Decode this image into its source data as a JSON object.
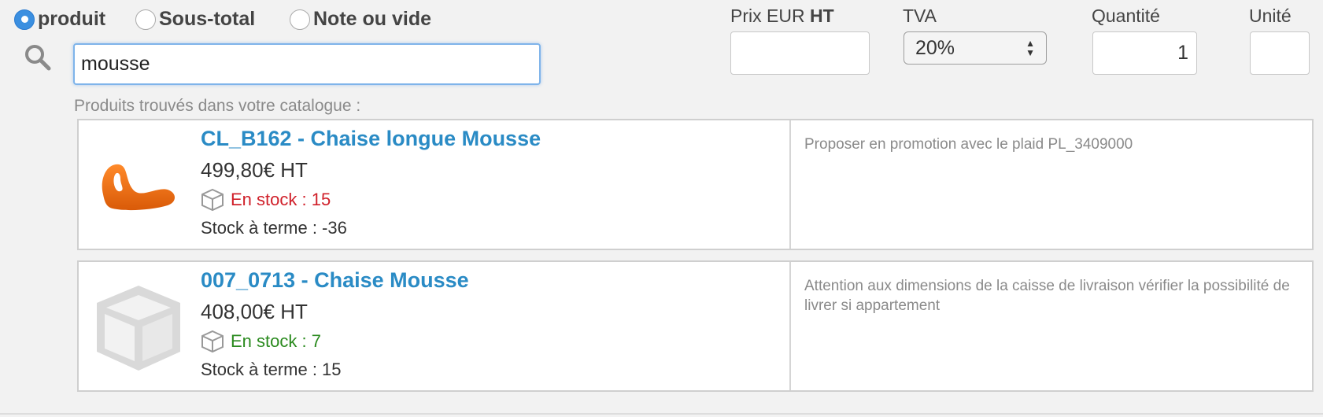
{
  "line_type": {
    "options": [
      {
        "label": "produit",
        "checked": true
      },
      {
        "label": "Sous-total",
        "checked": false
      },
      {
        "label": "Note ou vide",
        "checked": false
      }
    ]
  },
  "search": {
    "value": "mousse",
    "icon": "search-icon"
  },
  "fields": {
    "price_label": "Prix EUR ",
    "price_label_bold": "HT",
    "price_value": "",
    "tva_label": "TVA",
    "tva_value": "20%",
    "qty_label": "Quantité",
    "qty_value": "1",
    "unit_label": "Unité",
    "unit_value": ""
  },
  "results": {
    "heading": "Produits trouvés dans votre catalogue :",
    "items": [
      {
        "title": "CL_B162 - Chaise longue Mousse",
        "price": "499,80€ HT",
        "stock": "En stock : 15",
        "stock_color": "#d0202a",
        "term": "Stock à terme : -36",
        "note": "Proposer en promotion avec le plaid PL_3409000",
        "thumb": "orange-chaise-image"
      },
      {
        "title": "007_0713 - Chaise Mousse",
        "price": "408,00€ HT",
        "stock": "En stock : 7",
        "stock_color": "#2a8a1e",
        "term": "Stock à terme : 15",
        "note": "Attention aux dimensions de la caisse de livraison vérifier la possibilité de livrer si appartement",
        "thumb": "box-placeholder-icon"
      }
    ]
  },
  "colors": {
    "accent": "#2a8bc5",
    "radio_checked": "#3b8fe0",
    "focus": "#7fb4ea"
  }
}
